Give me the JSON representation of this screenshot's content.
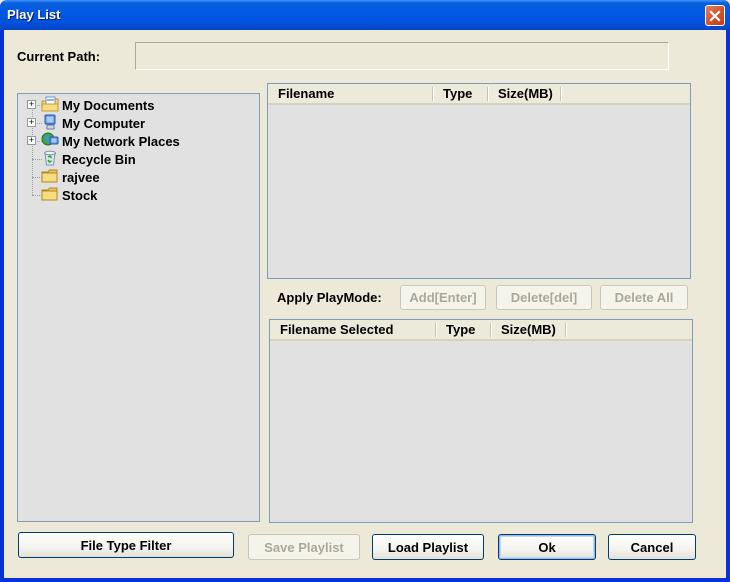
{
  "window": {
    "title": "Play List",
    "close_label": "Close"
  },
  "current_path": {
    "label": "Current Path:",
    "value": ""
  },
  "tree": {
    "items": [
      {
        "label": "My Documents",
        "icon": "my-documents-icon",
        "expandable": true,
        "expander": "+"
      },
      {
        "label": "My Computer",
        "icon": "my-computer-icon",
        "expandable": true,
        "expander": "+"
      },
      {
        "label": "My Network Places",
        "icon": "network-places-icon",
        "expandable": true,
        "expander": "+"
      },
      {
        "label": "Recycle Bin",
        "icon": "recycle-bin-icon",
        "expandable": false
      },
      {
        "label": "rajvee",
        "icon": "folder-icon",
        "expandable": false
      },
      {
        "label": "Stock",
        "icon": "folder-icon",
        "expandable": false
      }
    ]
  },
  "file_list": {
    "columns": [
      "Filename",
      "Type",
      "Size(MB)"
    ],
    "rows": []
  },
  "playmode": {
    "label": "Apply PlayMode:",
    "add_label": "Add[Enter]",
    "delete_label": "Delete[del]",
    "delete_all_label": "Delete All"
  },
  "selected_list": {
    "columns": [
      "Filename Selected",
      "Type",
      "Size(MB)"
    ],
    "rows": []
  },
  "footer": {
    "file_type_filter_label": "File Type Filter",
    "save_playlist_label": "Save Playlist",
    "load_playlist_label": "Load Playlist",
    "ok_label": "Ok",
    "cancel_label": "Cancel"
  },
  "colors": {
    "titlebar": "#0058e6",
    "client_bg": "#ece9d8",
    "panel_bg": "#e1e1e1",
    "panel_border": "#7f9db9",
    "close_button": "#d3502c"
  }
}
